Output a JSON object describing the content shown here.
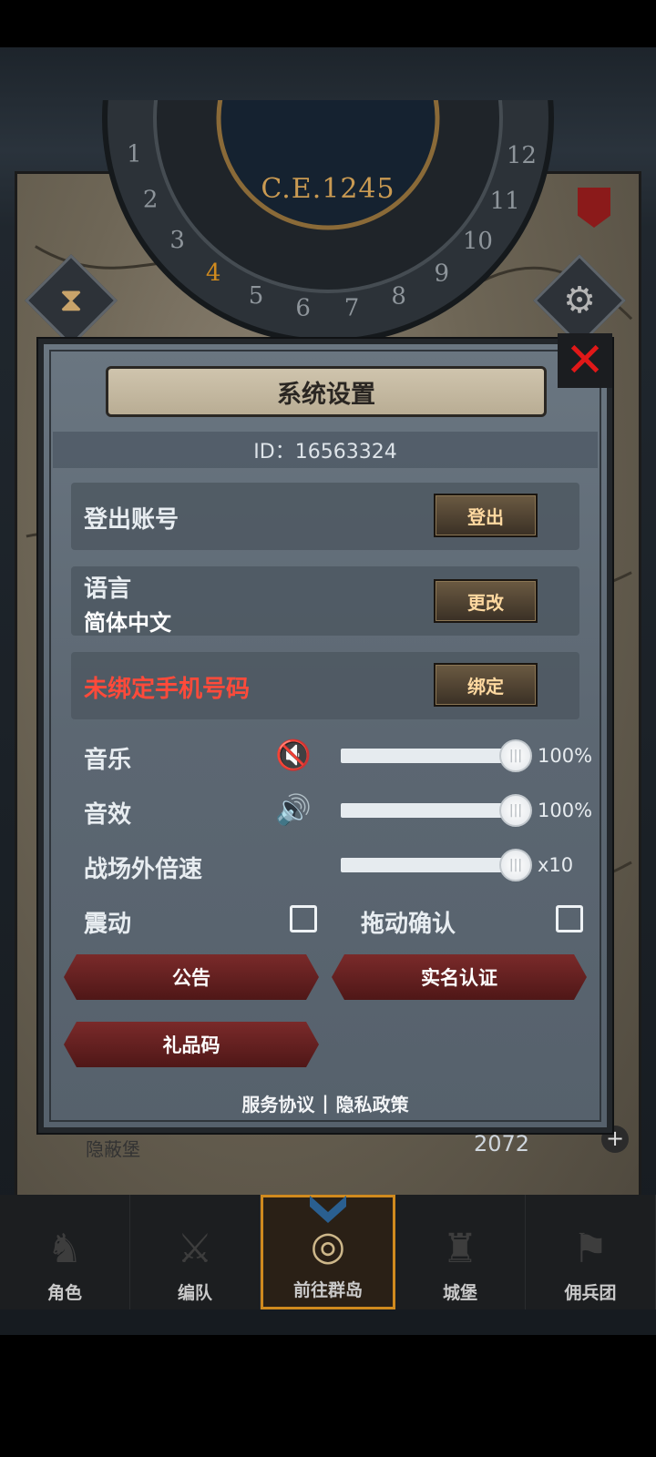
{
  "world": {
    "era": "C.E.1245",
    "wheel_numbers": [
      "1",
      "2",
      "3",
      "4",
      "5",
      "6",
      "7",
      "8",
      "9",
      "10",
      "11",
      "12"
    ],
    "strip_label": "隐蔽堡",
    "resource_value": "2072",
    "plus": "+"
  },
  "dialog": {
    "title": "系统设置",
    "id_text": "ID：16563324",
    "close_glyph": "✕",
    "logout": {
      "label": "登出账号",
      "button": "登出"
    },
    "language": {
      "label": "语言",
      "value": "简体中文",
      "button": "更改"
    },
    "phone": {
      "label": "未绑定手机号码",
      "button": "绑定"
    },
    "music": {
      "label": "音乐",
      "value": "100%",
      "level": 1.0,
      "icon": "speaker-muted-icon",
      "glyph": "🔇"
    },
    "sfx": {
      "label": "音效",
      "value": "100%",
      "level": 1.0,
      "icon": "speaker-icon",
      "glyph": "🔊"
    },
    "speed": {
      "label": "战场外倍速",
      "value": "x10",
      "level": 1.0
    },
    "vibration": {
      "label": "震动",
      "checked": false
    },
    "drag_confirm": {
      "label": "拖动确认",
      "checked": false
    },
    "buttons": {
      "notice": "公告",
      "verify": "实名认证",
      "gift": "礼品码"
    },
    "footer": {
      "terms": "服务协议",
      "separator": "|",
      "privacy": "隐私政策"
    }
  },
  "nav": {
    "items": [
      {
        "label": "角色",
        "icon": "knight-icon",
        "glyph": "♞"
      },
      {
        "label": "编队",
        "icon": "helmet-icon",
        "glyph": "⚔"
      },
      {
        "label": "前往群岛",
        "icon": "globe-icon",
        "glyph": "◎"
      },
      {
        "label": "城堡",
        "icon": "castle-icon",
        "glyph": "♜"
      },
      {
        "label": "佣兵团",
        "icon": "banner-icon",
        "glyph": "⚑"
      }
    ],
    "active_index": 2
  },
  "colors": {
    "accent_gold": "#d08a1e",
    "warning_red": "#ff4a3a",
    "close_red": "#e01818"
  }
}
